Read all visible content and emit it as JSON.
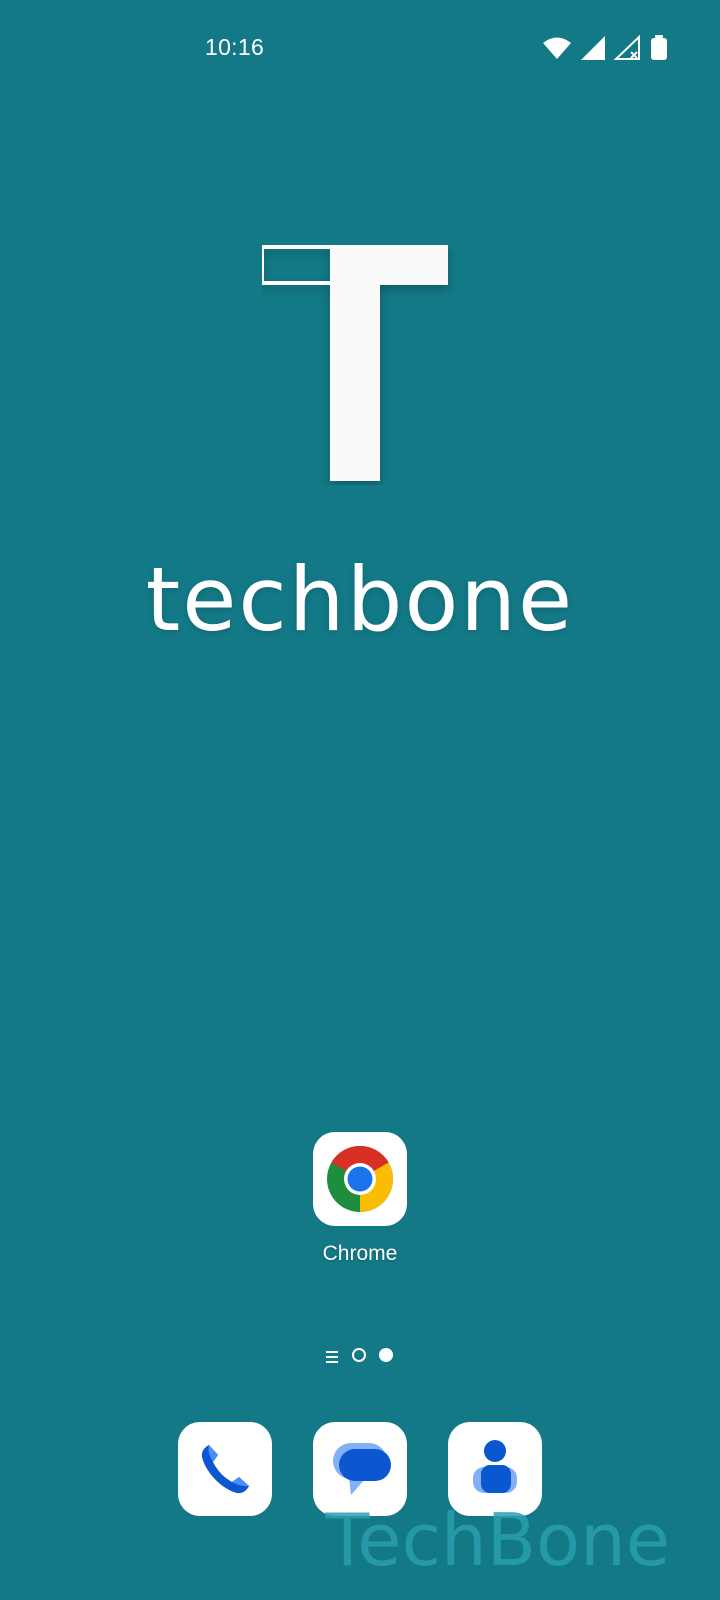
{
  "status_bar": {
    "time": "10:16",
    "icons": [
      "wifi-icon",
      "cell-signal-icon",
      "cell-signal-no-service-icon",
      "battery-icon"
    ]
  },
  "wallpaper": {
    "logo_letter": "T",
    "wordmark": "techbone"
  },
  "home_apps": [
    {
      "label": "Chrome",
      "icon": "chrome-icon"
    }
  ],
  "page_indicator": {
    "pages": 2,
    "current_page": 2,
    "has_list_icon": true
  },
  "dock": [
    {
      "icon": "phone-icon"
    },
    {
      "icon": "messages-icon"
    },
    {
      "icon": "contacts-icon"
    }
  ],
  "watermark": "TechBone",
  "colors": {
    "background": "#137986",
    "accent_blue": "#0b57d0",
    "light_blue": "#4c8df6"
  }
}
